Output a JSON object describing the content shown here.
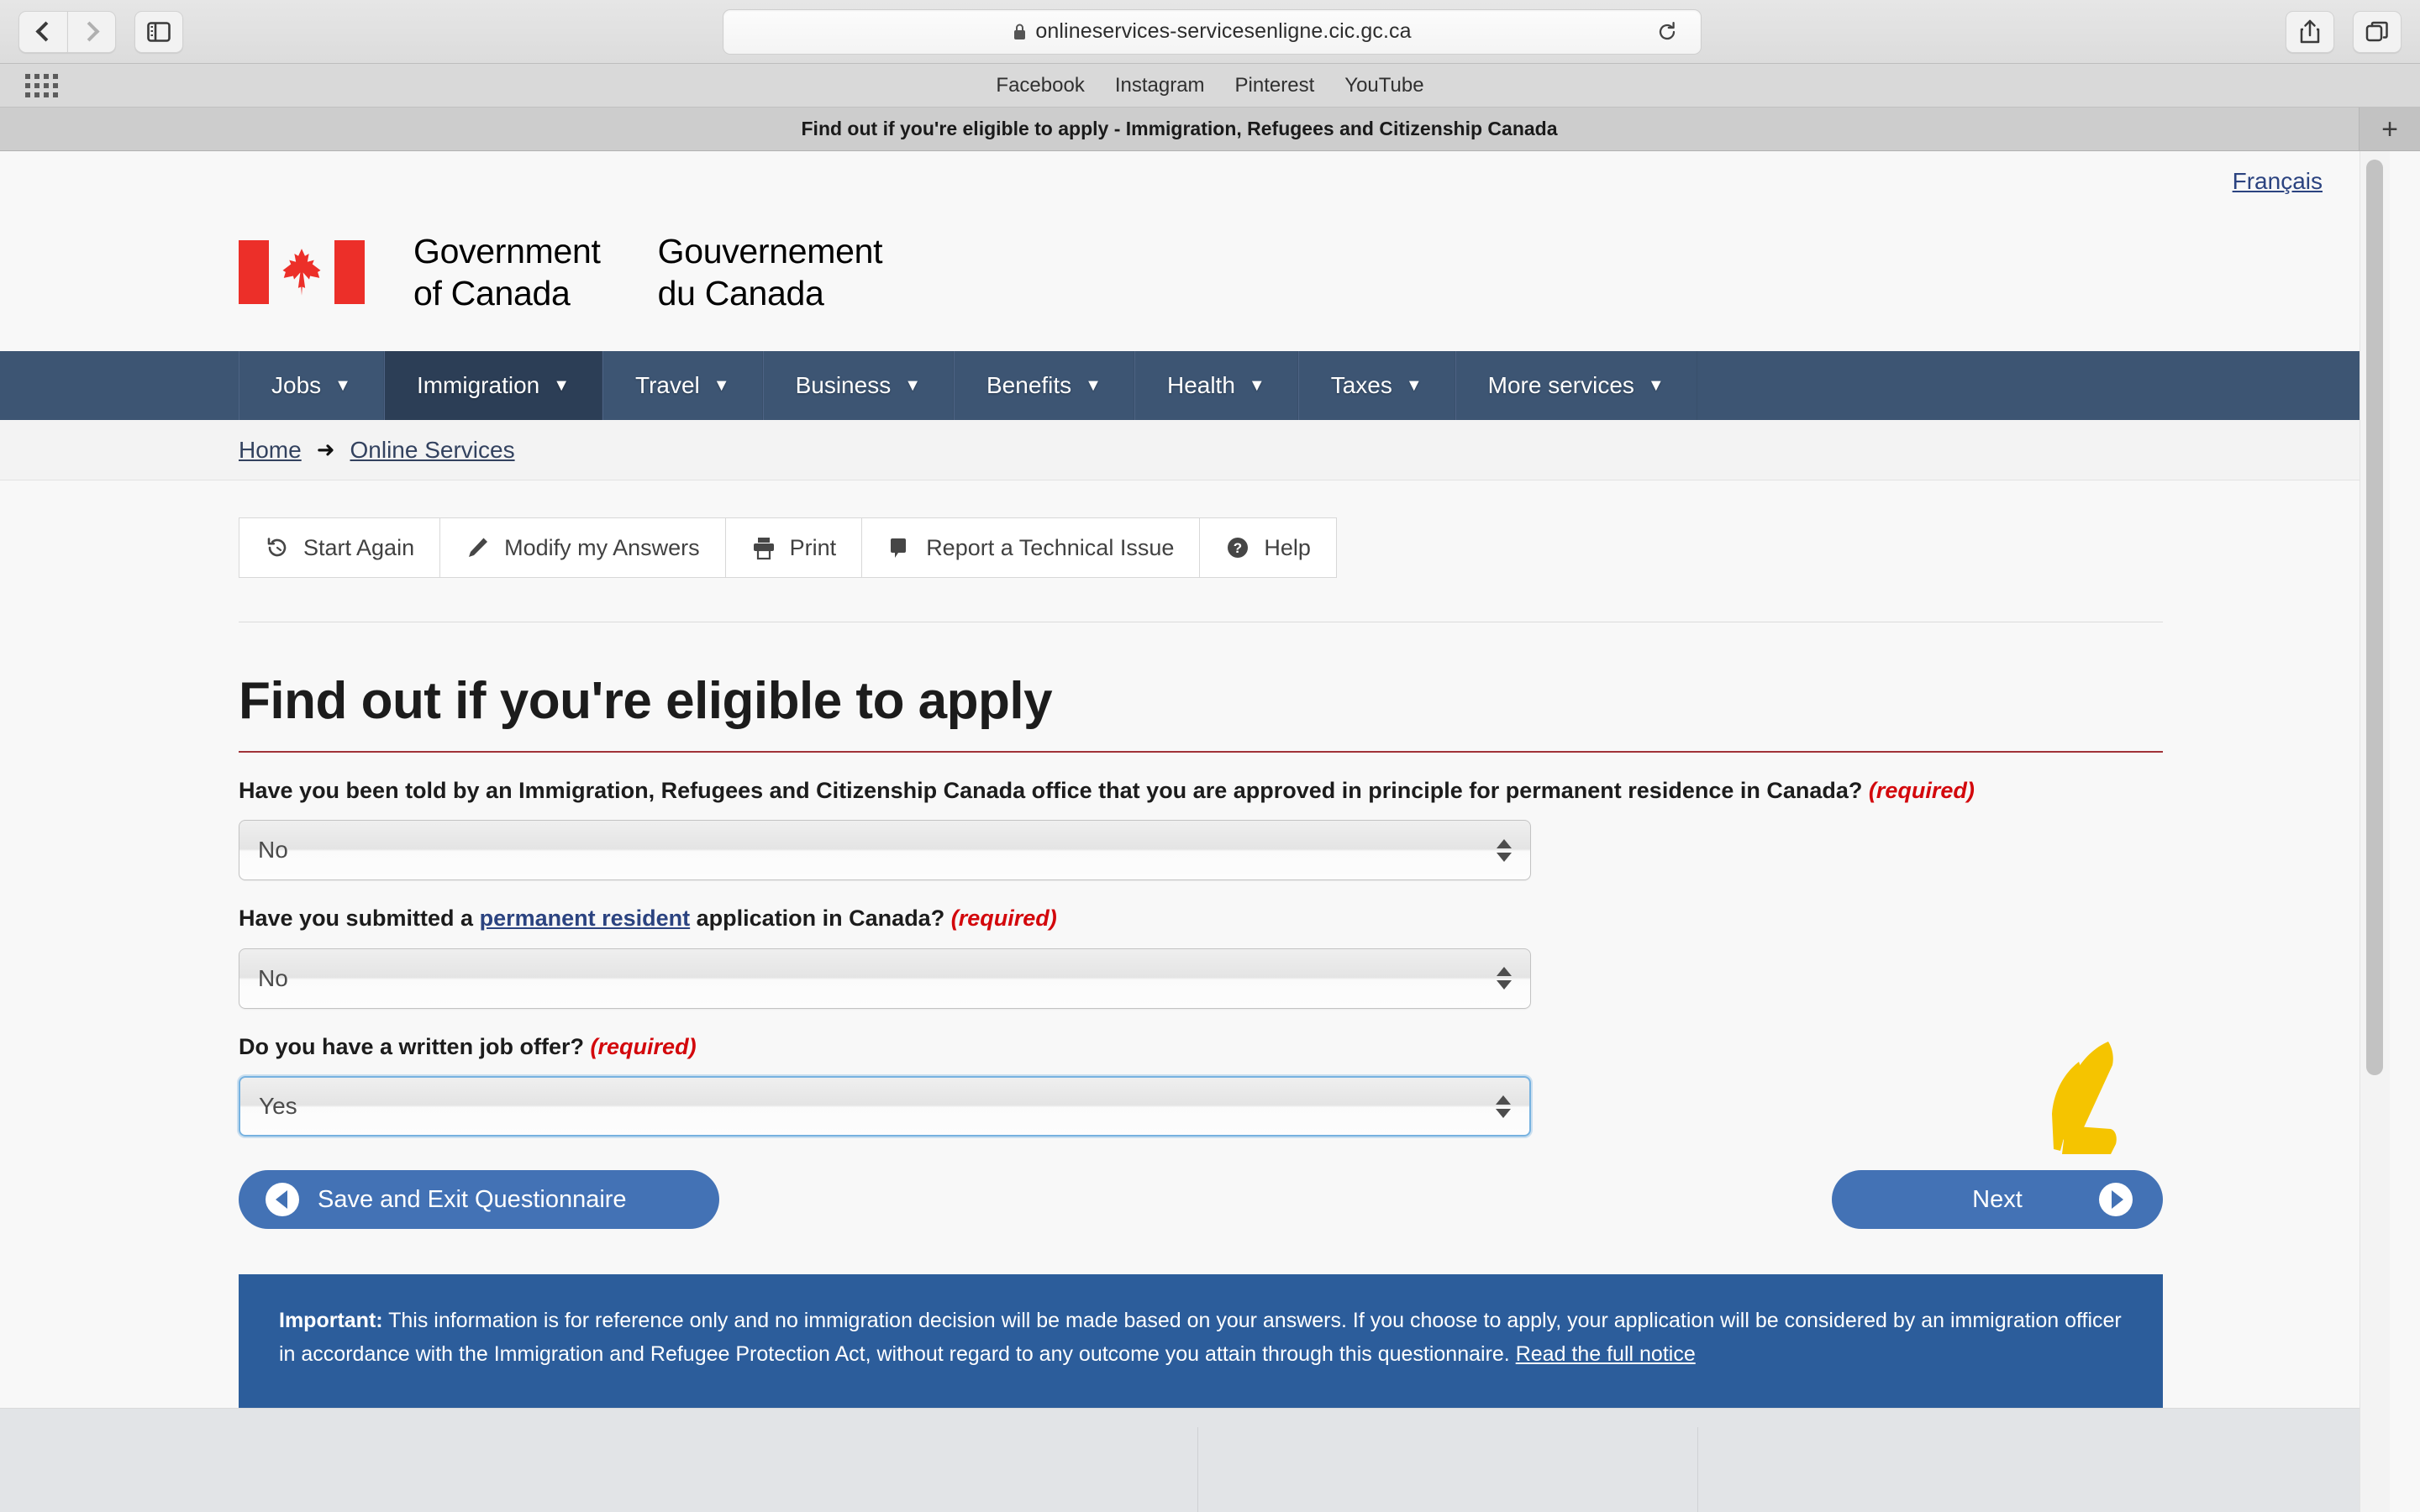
{
  "browser": {
    "url": "onlineservices-servicesenligne.cic.gc.ca",
    "lock_icon": "lock-icon",
    "reload_icon": "reload-icon",
    "back_icon": "back-chevron-icon",
    "forward_icon": "forward-chevron-icon",
    "sidebar_icon": "sidebar-toggle-icon",
    "share_icon": "share-icon",
    "tabs_icon": "tab-overview-icon",
    "apps_icon": "apps-grid-icon",
    "new_tab_label": "+",
    "bookmarks": [
      {
        "label": "Facebook"
      },
      {
        "label": "Instagram"
      },
      {
        "label": "Pinterest"
      },
      {
        "label": "YouTube"
      }
    ],
    "tab_title": "Find out if you're eligible to apply - Immigration, Refugees and Citizenship Canada"
  },
  "page": {
    "language_toggle": "Français",
    "brand": {
      "english": "Government\nof Canada",
      "english_line1": "Government",
      "english_line2": "of Canada",
      "french_line1": "Gouvernement",
      "french_line2": "du Canada",
      "flag_icon": "canada-flag-icon"
    },
    "nav": [
      {
        "label": "Jobs",
        "active": false
      },
      {
        "label": "Immigration",
        "active": true
      },
      {
        "label": "Travel",
        "active": false
      },
      {
        "label": "Business",
        "active": false
      },
      {
        "label": "Benefits",
        "active": false
      },
      {
        "label": "Health",
        "active": false
      },
      {
        "label": "Taxes",
        "active": false
      },
      {
        "label": "More services",
        "active": false
      }
    ],
    "breadcrumb": {
      "home": "Home",
      "arrow": "➜",
      "current": "Online Services"
    },
    "toolbar": [
      {
        "label": "Start Again",
        "icon": "restart-icon"
      },
      {
        "label": "Modify my Answers",
        "icon": "pencil-icon"
      },
      {
        "label": "Print",
        "icon": "printer-icon"
      },
      {
        "label": "Report a Technical Issue",
        "icon": "speech-bubble-icon"
      },
      {
        "label": "Help",
        "icon": "question-mark-icon"
      }
    ],
    "title": "Find out if you're eligible to apply",
    "questions": [
      {
        "text_before": "Have you been told by an Immigration, Refugees and Citizenship Canada office that you are approved in principle for permanent residence in Canada? ",
        "required_label": "(required)",
        "value": "No",
        "focused": false
      },
      {
        "text_before": "Have you submitted a ",
        "link_text": "permanent resident",
        "text_after": " application in Canada? ",
        "required_label": "(required)",
        "value": "No",
        "focused": false
      },
      {
        "text_before": "Do you have a written job offer? ",
        "required_label": "(required)",
        "value": "Yes",
        "focused": true
      }
    ],
    "buttons": {
      "save_label": "Save and Exit Questionnaire",
      "next_label": "Next"
    },
    "notice": {
      "important_label": "Important:",
      "body": " This information is for reference only and no immigration decision will be made based on your answers. If you choose to apply, your application will be considered by an immigration officer in accordance with the Immigration and Refugee Protection Act, without regard to any outcome you attain through this questionnaire. ",
      "link": "Read the full notice"
    },
    "annotation": {
      "icon": "yellow-arrow-annotation",
      "color": "#f5c400"
    }
  },
  "colors": {
    "nav_blue": "#3d5573",
    "nav_active": "#2c3e56",
    "link_blue": "#2b4380",
    "required_red": "#d3080c",
    "title_rule": "#a03338",
    "button_blue": "#4372b5",
    "notice_blue": "#2c5d9b",
    "flag_red": "#ec2f29"
  }
}
